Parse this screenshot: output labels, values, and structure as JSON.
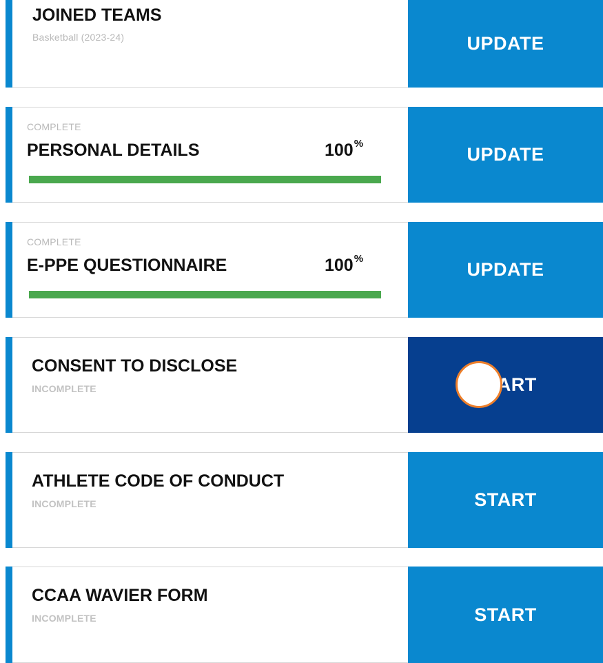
{
  "cards": [
    {
      "title": "JOINED TEAMS",
      "subtitle": "Basketball  (2023-24)",
      "button": "UPDATE"
    },
    {
      "status": "COMPLETE",
      "title": "PERSONAL DETAILS",
      "percent": "100",
      "percent_unit": "%",
      "progress": 1.0,
      "button": "UPDATE"
    },
    {
      "status": "COMPLETE",
      "title": "E-PPE QUESTIONNAIRE",
      "percent": "100",
      "percent_unit": "%",
      "progress": 1.0,
      "button": "UPDATE"
    },
    {
      "title": "CONSENT TO DISCLOSE",
      "status": "INCOMPLETE",
      "button": "START"
    },
    {
      "title": "ATHLETE CODE OF CONDUCT",
      "status": "INCOMPLETE",
      "button": "START"
    },
    {
      "title": "CCAA WAVIER FORM",
      "status": "INCOMPLETE",
      "button": "START"
    }
  ],
  "colors": {
    "accent": "#0a88cf",
    "button_pressed": "#063f8f",
    "progress_fill": "#4aa84e",
    "touch_ring": "#ed7f2b"
  }
}
